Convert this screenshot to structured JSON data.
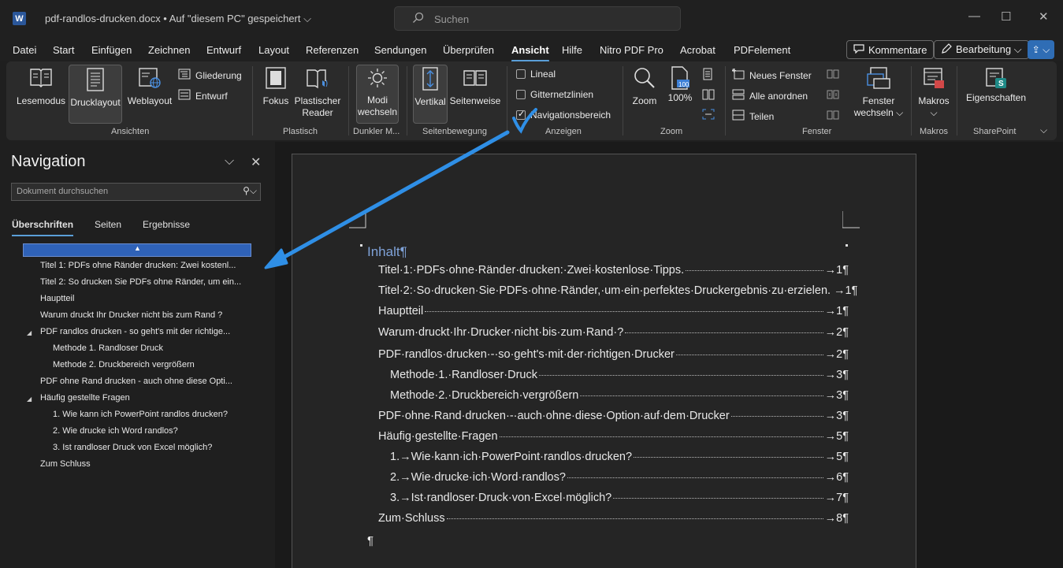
{
  "titlebar": {
    "app_icon": "W",
    "document_title": "pdf-randlos-drucken.docx  •  Auf \"diesem PC\" gespeichert ⌵",
    "search_placeholder": "Suchen",
    "window_controls": [
      "—",
      "☐",
      "✕"
    ]
  },
  "menu": {
    "tabs": [
      "Datei",
      "Start",
      "Einfügen",
      "Zeichnen",
      "Entwurf",
      "Layout",
      "Referenzen",
      "Sendungen",
      "Überprüfen",
      "Ansicht",
      "Hilfe",
      "Nitro PDF Pro",
      "Acrobat",
      "PDFelement"
    ],
    "active_tab": "Ansicht",
    "comments_label": "Kommentare",
    "editing_label": "Bearbeitung ⌵",
    "share_label": "⇪ ⌵"
  },
  "ribbon": {
    "ansichten": {
      "label": "Ansichten",
      "lesemodus": "Lesemodus",
      "drucklayout": "Drucklayout",
      "weblayout": "Weblayout",
      "gliederung": "Gliederung",
      "entwurf": "Entwurf"
    },
    "plastisch": {
      "label": "Plastisch",
      "fokus": "Fokus",
      "reader_line1": "Plastischer",
      "reader_line2": "Reader"
    },
    "dunkler": {
      "label": "Dunkler M...",
      "modi_line1": "Modi",
      "modi_line2": "wechseln"
    },
    "seitenbewegung": {
      "label": "Seitenbewegung",
      "vertikal": "Vertikal",
      "seitenweise": "Seitenweise"
    },
    "anzeigen": {
      "label": "Anzeigen",
      "lineal": "Lineal",
      "gitternetzlinien": "Gitternetzlinien",
      "navigationsbereich": "Navigationsbereich",
      "lineal_checked": false,
      "gitternetzlinien_checked": false,
      "navigationsbereich_checked": true
    },
    "zoom": {
      "label": "Zoom",
      "zoom": "Zoom",
      "percent": "100%",
      "percent_icon": "100"
    },
    "fenster": {
      "label": "Fenster",
      "neues_fenster": "Neues Fenster",
      "alle_anordnen": "Alle anordnen",
      "teilen": "Teilen",
      "fenster_line1": "Fenster",
      "fenster_line2": "wechseln ⌵"
    },
    "makros": {
      "label": "Makros",
      "makros": "Makros",
      "makros_arrow": "⌵"
    },
    "sharepoint": {
      "label": "SharePoint",
      "eigenschaften": "Eigenschaften",
      "icon_letter": "S"
    },
    "collapse": "⌵"
  },
  "nav": {
    "title": "Navigation",
    "options_icon": "⌵",
    "close_icon": "✕",
    "search_placeholder": "Dokument durchsuchen",
    "search_icon": "⚲⌵",
    "tabs": [
      "Überschriften",
      "Seiten",
      "Ergebnisse"
    ],
    "selected_marker": "▲",
    "items": [
      {
        "text": "Titel 1: PDFs ohne Ränder drucken: Zwei kostenl...",
        "level": 1,
        "arrow": ""
      },
      {
        "text": "Titel 2: So drucken Sie PDFs ohne Ränder, um ein...",
        "level": 1,
        "arrow": ""
      },
      {
        "text": "Hauptteil",
        "level": 1,
        "arrow": ""
      },
      {
        "text": "Warum druckt Ihr Drucker nicht bis zum Rand ?",
        "level": 1,
        "arrow": ""
      },
      {
        "text": "PDF randlos drucken - so geht's mit der richtige...",
        "level": 1,
        "arrow": "◢"
      },
      {
        "text": "Methode 1. Randloser Druck",
        "level": 2,
        "arrow": ""
      },
      {
        "text": "Methode 2. Druckbereich vergrößern",
        "level": 2,
        "arrow": ""
      },
      {
        "text": "PDF ohne Rand drucken - auch ohne diese Opti...",
        "level": 1,
        "arrow": ""
      },
      {
        "text": "Häufig gestellte Fragen",
        "level": 1,
        "arrow": "◢"
      },
      {
        "text": "1. Wie kann ich PowerPoint randlos drucken?",
        "level": 2,
        "arrow": ""
      },
      {
        "text": "2. Wie drucke ich Word randlos?",
        "level": 2,
        "arrow": ""
      },
      {
        "text": "3. Ist randloser Druck von Excel möglich?",
        "level": 2,
        "arrow": ""
      },
      {
        "text": "Zum Schluss",
        "level": 1,
        "arrow": ""
      }
    ]
  },
  "document": {
    "toc_heading": "Inhalt¶",
    "toc": [
      {
        "text": "Titel·1:·PDFs·ohne·Ränder·drucken:·Zwei·kostenlose·Tipps.",
        "page": "→1¶",
        "indent": 0
      },
      {
        "text": "Titel·2:·So·drucken·Sie·PDFs·ohne·Ränder,·um·ein·perfektes·Druckergebnis·zu·erzielen.",
        "page": "→1¶",
        "indent": 0
      },
      {
        "text": "Hauptteil",
        "page": "→1¶",
        "indent": 0
      },
      {
        "text": "Warum·druckt·Ihr·Drucker·nicht·bis·zum·Rand·?",
        "page": "→2¶",
        "indent": 0
      },
      {
        "text": "PDF·randlos·drucken·-·so·geht's·mit·der·richtigen·Drucker",
        "page": "→2¶",
        "indent": 0
      },
      {
        "text": "Methode·1.·Randloser·Druck",
        "page": "→3¶",
        "indent": 1
      },
      {
        "text": "Methode·2.·Druckbereich·vergrößern",
        "page": "→3¶",
        "indent": 1
      },
      {
        "text": "PDF·ohne·Rand·drucken·-·auch·ohne·diese·Option·auf·dem·Drucker",
        "page": "→3¶",
        "indent": 0
      },
      {
        "text": "Häufig·gestellte·Fragen",
        "page": "→5¶",
        "indent": 0
      },
      {
        "text": "1.→Wie·kann·ich·PowerPoint·randlos·drucken?",
        "page": "→5¶",
        "indent": 1
      },
      {
        "text": "2.→Wie·drucke·ich·Word·randlos?",
        "page": "→6¶",
        "indent": 1
      },
      {
        "text": "3.→Ist·randloser·Druck·von·Excel·möglich?",
        "page": "→7¶",
        "indent": 1
      },
      {
        "text": "Zum·Schluss",
        "page": "→8¶",
        "indent": 0
      }
    ],
    "trailing_mark": "¶"
  },
  "colors": {
    "accent": "#5a9fd8",
    "annotation_arrow": "#2f8fe6",
    "nav_selection": "#2f62b8",
    "toc_heading": "#7fa2d8"
  }
}
